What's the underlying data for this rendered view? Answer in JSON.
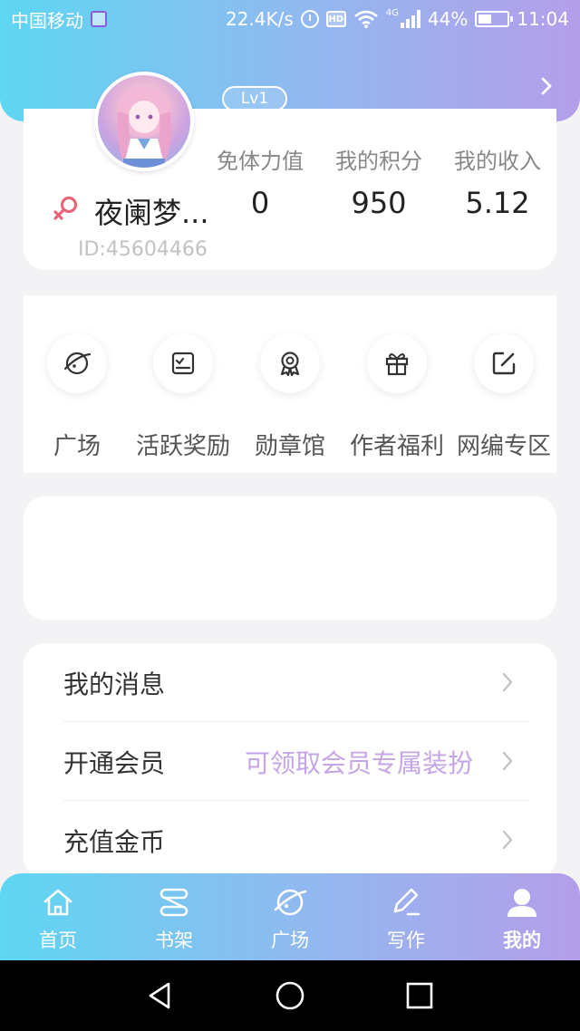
{
  "status_bar": {
    "carrier": "中国移动",
    "speed": "22.4K/s",
    "hd": "HD",
    "network": "4G",
    "battery": "44%",
    "time": "11:04"
  },
  "profile": {
    "level": "Lv1",
    "username": "夜阑梦...",
    "user_id": "ID:45604466",
    "stats": [
      {
        "label": "免体力值",
        "value": "0"
      },
      {
        "label": "我的积分",
        "value": "950"
      },
      {
        "label": "我的收入",
        "value": "5.12"
      }
    ]
  },
  "actions": [
    {
      "label": "广场",
      "icon": "planet-icon"
    },
    {
      "label": "活跃奖励",
      "icon": "checklist-icon"
    },
    {
      "label": "勋章馆",
      "icon": "medal-icon"
    },
    {
      "label": "作者福利",
      "icon": "gift-icon"
    },
    {
      "label": "网编专区",
      "icon": "edit-icon"
    }
  ],
  "menu": [
    {
      "label": "我的消息",
      "sub": ""
    },
    {
      "label": "开通会员",
      "sub": "可领取会员专属装扮"
    },
    {
      "label": "充值金币",
      "sub": ""
    }
  ],
  "tabs": [
    {
      "label": "首页",
      "icon": "home-icon"
    },
    {
      "label": "书架",
      "icon": "bookshelf-icon"
    },
    {
      "label": "广场",
      "icon": "planet-icon"
    },
    {
      "label": "写作",
      "icon": "pen-icon"
    },
    {
      "label": "我的",
      "icon": "person-icon"
    }
  ],
  "colors": {
    "gradient_start": "#5ed6f2",
    "gradient_end": "#b49ee9",
    "accent_purple": "#c6a4e8",
    "female_icon": "#e8657a"
  }
}
